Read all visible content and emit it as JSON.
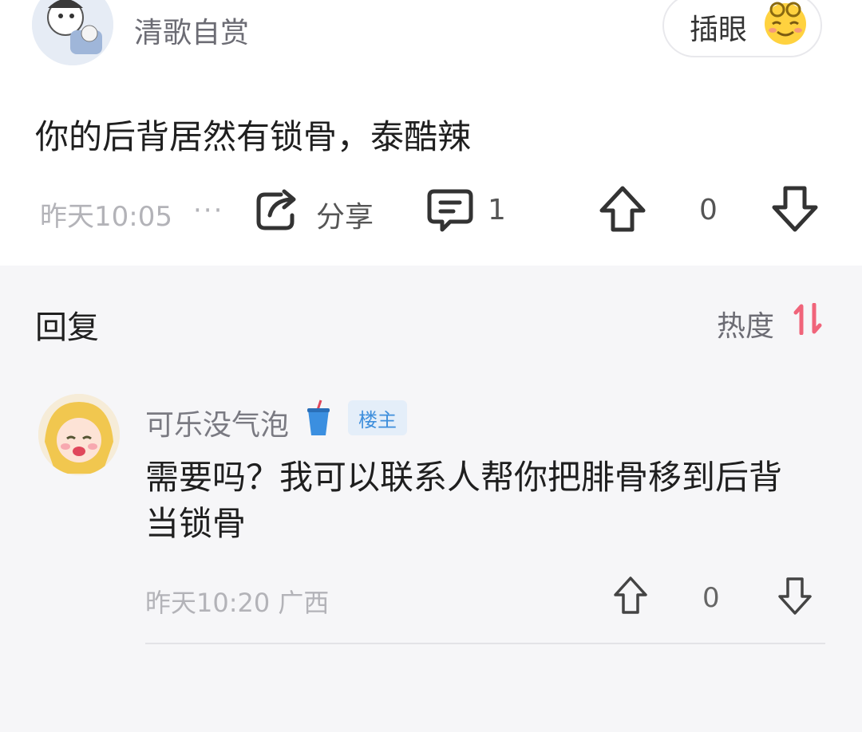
{
  "post": {
    "username": "清歌自赏",
    "insert_button_label": "插眼",
    "insert_button_icon": "smiling-face-emoji-icon",
    "text": "你的后背居然有锁骨，泰酷辣",
    "time": "昨天10:05",
    "more": "···",
    "share_label": "分享",
    "comment_count": "1",
    "vote_count": "0"
  },
  "replies": {
    "title": "回复",
    "sort_label": "热度",
    "sort_icon": "sort-arrows-icon",
    "accent_color": "#f0647a"
  },
  "reply": {
    "username": "可乐没气泡",
    "name_emoji": "cup-with-straw-icon",
    "badge": "楼主",
    "text": "需要吗？我可以联系人帮你把腓骨移到后背当锁骨",
    "time": "昨天10:20 广西",
    "vote_count": "0"
  }
}
